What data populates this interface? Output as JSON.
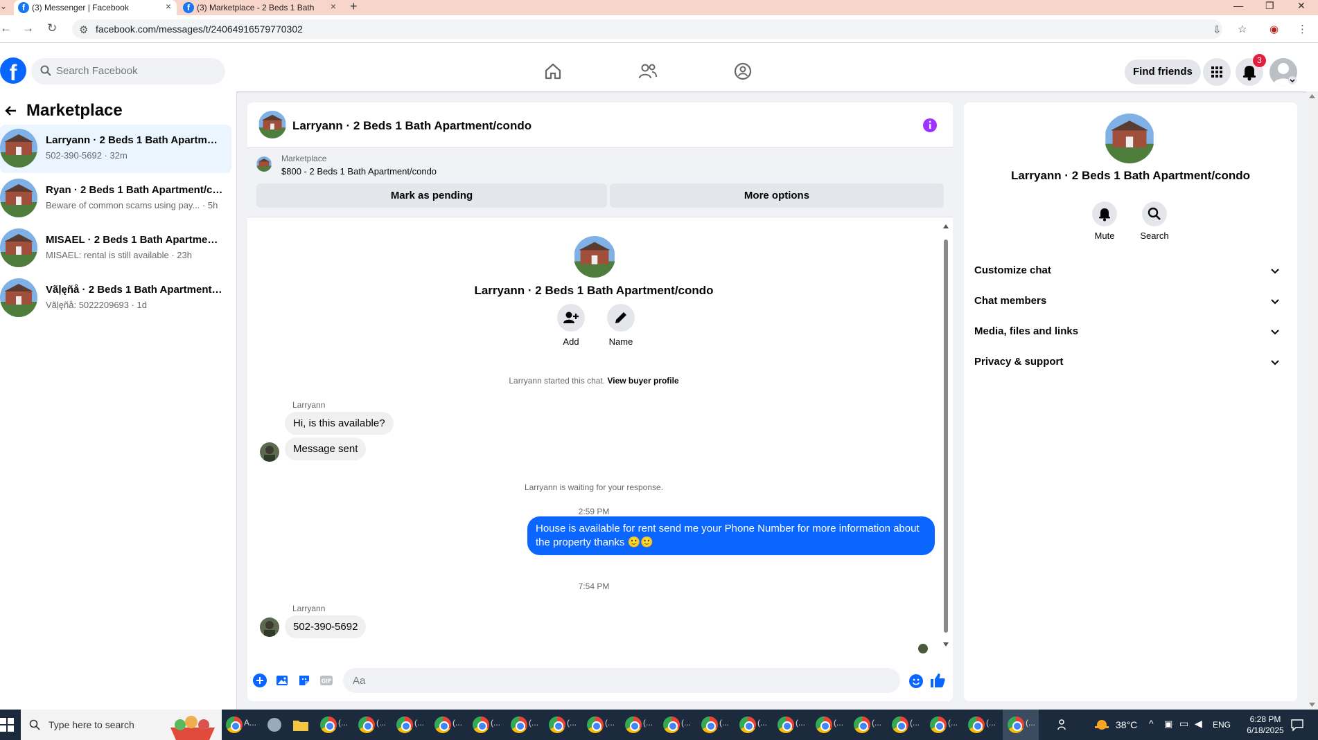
{
  "browser": {
    "tabs": [
      {
        "title": "(3) Messenger | Facebook"
      },
      {
        "title": "(3) Marketplace - 2 Beds 1 Bath"
      }
    ],
    "url": "facebook.com/messages/t/24064916579770302"
  },
  "header": {
    "logo_letter": "f",
    "search_placeholder": "Search Facebook",
    "find_friends_label": "Find friends",
    "notification_count": "3"
  },
  "sidebar": {
    "title": "Marketplace",
    "conversations": [
      {
        "name": "Larryann · 2 Beds 1 Bath Apartmen...",
        "preview": "502-390-5692 · 32m"
      },
      {
        "name": "Ryan · 2 Beds 1 Bath Apartment/co...",
        "preview": "Beware of common scams using pay... · 5h"
      },
      {
        "name": "MISAEL · 2 Beds 1 Bath Apartment...",
        "preview": "MISAEL: rental is still available · 23h"
      },
      {
        "name": "Vãļęñå · 2 Beds 1 Bath Apartment/...",
        "preview": "Vãļęñå: 5022209693 · 1d"
      }
    ]
  },
  "chat": {
    "title": "Larryann · 2 Beds 1 Bath Apartment/condo",
    "listing": {
      "label": "Marketplace",
      "price_title": "$800 - 2 Beds 1 Bath Apartment/condo",
      "mark_pending": "Mark as pending",
      "more_options": "More options"
    },
    "intro_name": "Larryann · 2 Beds 1 Bath Apartment/condo",
    "add_label": "Add",
    "name_label": "Name",
    "started_text": "Larryann started this chat.",
    "view_buyer": "View buyer profile",
    "sender_1": "Larryann",
    "msg_1": "Hi, is this available?",
    "msg_2": "Message sent",
    "waiting_text": "Larryann is waiting for your response.",
    "time_1": "2:59 PM",
    "msg_out": "House is available for rent send me your Phone Number for more information about the property thanks 🙂🙂",
    "time_2": "7:54 PM",
    "sender_2": "Larryann",
    "msg_3": "502-390-5692",
    "composer_placeholder": "Aa"
  },
  "details": {
    "title": "Larryann · 2 Beds 1 Bath Apartment/condo",
    "mute_label": "Mute",
    "search_label": "Search",
    "sections": [
      "Customize chat",
      "Chat members",
      "Media, files and links",
      "Privacy & support"
    ]
  },
  "taskbar": {
    "search_placeholder": "Type here to search",
    "app_label_short": "A...",
    "chrome_label": "(...",
    "temperature": "38°C",
    "language": "ENG",
    "time": "6:28 PM",
    "date": "6/18/2025"
  },
  "colors": {
    "fb_blue": "#0866ff",
    "outgoing_bubble": "#0a66ff",
    "info_purple": "#a033ff",
    "badge_red": "#e41e3f"
  }
}
